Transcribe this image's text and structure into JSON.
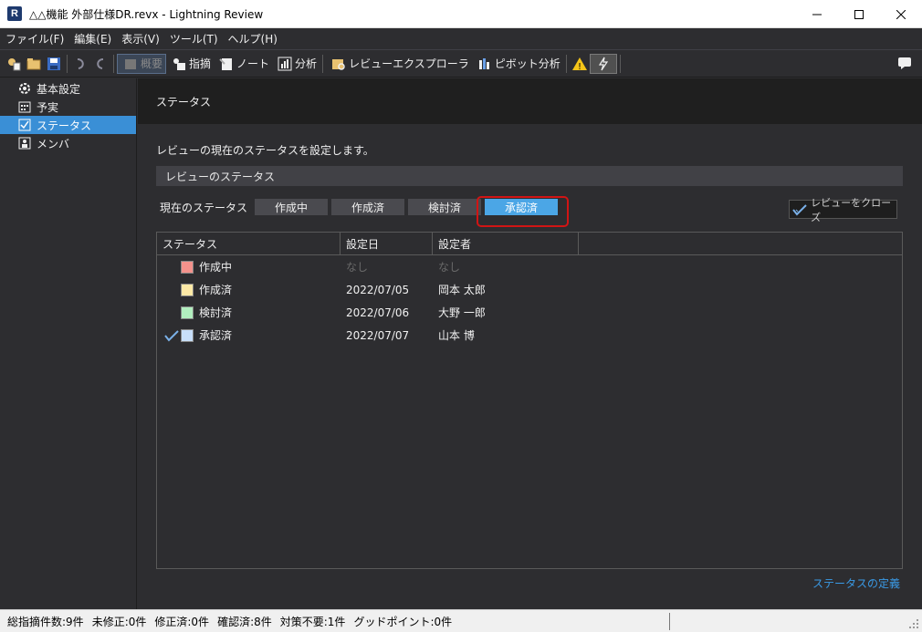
{
  "window": {
    "title": "△△機能 外部仕様DR.revx - Lightning Review",
    "app_icon_letter": "R"
  },
  "menu": [
    "ファイル(F)",
    "編集(E)",
    "表示(V)",
    "ツール(T)",
    "ヘルプ(H)"
  ],
  "toolbar": {
    "overview": "概要",
    "comments": "指摘",
    "note": "ノート",
    "analysis": "分析",
    "review_explorer": "レビューエクスプローラ",
    "pivot": "ピボット分析"
  },
  "sidebar": {
    "items": [
      {
        "label": "基本設定",
        "icon": "gear-icon"
      },
      {
        "label": "予実",
        "icon": "calendar-icon"
      },
      {
        "label": "ステータス",
        "icon": "status-icon",
        "active": true
      },
      {
        "label": "メンバ",
        "icon": "members-icon"
      }
    ]
  },
  "main": {
    "header_title": "ステータス",
    "description": "レビューの現在のステータスを設定します。",
    "section_title": "レビューのステータス",
    "current_status_label": "現在のステータス",
    "status_buttons": [
      "作成中",
      "作成済",
      "検討済",
      "承認済"
    ],
    "current_status": "承認済",
    "close_review_button": "レビューをクローズ",
    "table": {
      "headers": [
        "ステータス",
        "設定日",
        "設定者"
      ],
      "rows": [
        {
          "status": "作成中",
          "color": "#f4928c",
          "date": "なし",
          "user": "なし",
          "checked": false
        },
        {
          "status": "作成済",
          "color": "#fde9a6",
          "date": "2022/07/05",
          "user": "岡本 太郎",
          "checked": false
        },
        {
          "status": "検討済",
          "color": "#b2efbf",
          "date": "2022/07/06",
          "user": "大野 一郎",
          "checked": false
        },
        {
          "status": "承認済",
          "color": "#c8dffa",
          "date": "2022/07/07",
          "user": "山本 博",
          "checked": true
        }
      ]
    },
    "definition_link": "ステータスの定義"
  },
  "statusbar": {
    "segments": [
      "総指摘件数:9件",
      "未修正:0件",
      "修正済:0件",
      "確認済:8件",
      "対策不要:1件",
      "グッドポイント:0件"
    ]
  },
  "colors": {
    "accent": "#3a8fd6",
    "current_status_button": "#4ba6e6",
    "highlight": "#d11414",
    "link": "#3a9ae6"
  }
}
